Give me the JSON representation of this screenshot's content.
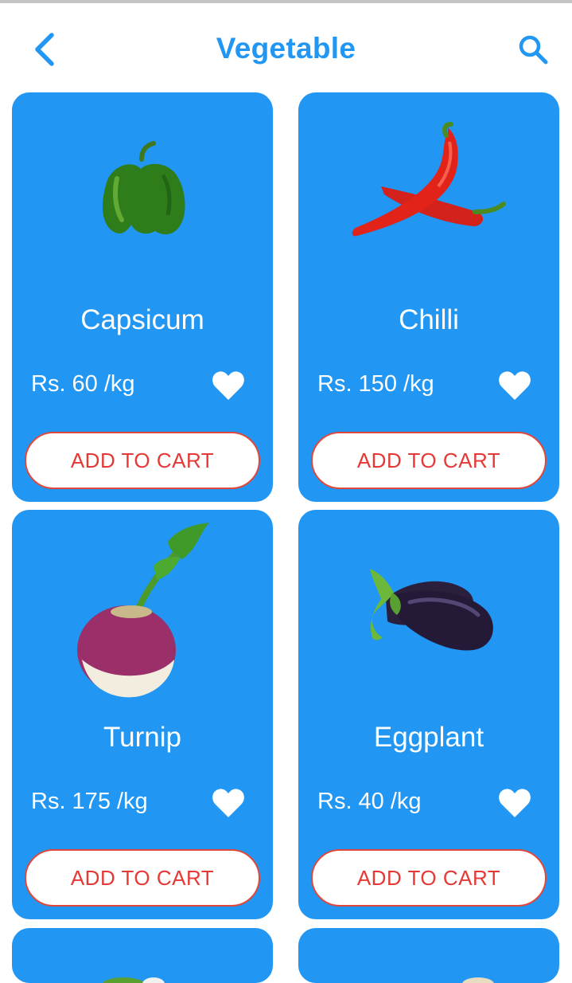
{
  "header": {
    "title": "Vegetable",
    "back_icon": "chevron-left-icon",
    "search_icon": "search-icon",
    "accent_color": "#2196f3"
  },
  "products": [
    {
      "name": "Capsicum",
      "price": "Rs. 60 /kg",
      "cart_label": "ADD TO CART",
      "image": "capsicum-image",
      "favorite_icon": "heart-icon"
    },
    {
      "name": "Chilli",
      "price": "Rs. 150 /kg",
      "cart_label": "ADD TO CART",
      "image": "chilli-image",
      "favorite_icon": "heart-icon"
    },
    {
      "name": "Turnip",
      "price": "Rs. 175 /kg",
      "cart_label": "ADD TO CART",
      "image": "turnip-image",
      "favorite_icon": "heart-icon"
    },
    {
      "name": "Eggplant",
      "price": "Rs. 40 /kg",
      "cart_label": "ADD TO CART",
      "image": "eggplant-image",
      "favorite_icon": "heart-icon"
    }
  ],
  "colors": {
    "card_background": "#2196f3",
    "button_text": "#e53935",
    "button_border": "#e0473a",
    "text_on_card": "#ffffff"
  }
}
